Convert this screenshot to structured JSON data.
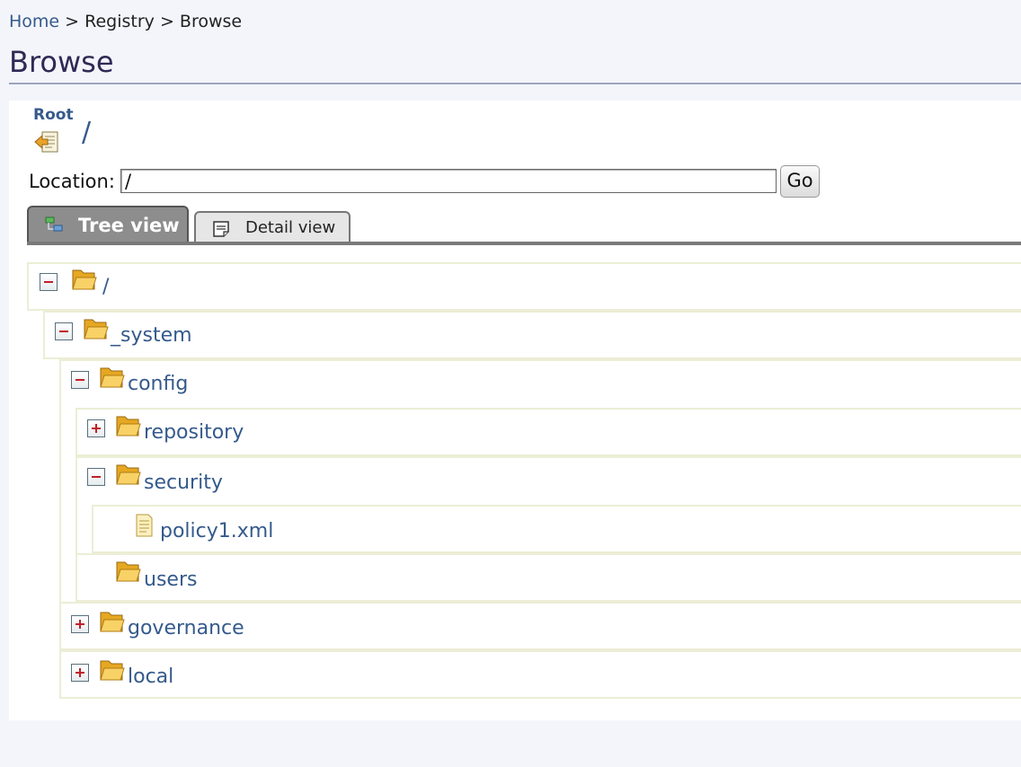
{
  "breadcrumb": {
    "home": "Home",
    "sep1": ">",
    "registry": "Registry",
    "sep2": ">",
    "current": "Browse"
  },
  "page": {
    "title": "Browse"
  },
  "root": {
    "label": "Root",
    "path": "/"
  },
  "location": {
    "label": "Location:",
    "value": "/",
    "go_label": "Go"
  },
  "tabs": {
    "tree_view": "Tree view",
    "detail_view": "Detail view",
    "active": "Tree view"
  },
  "tree": {
    "root": {
      "label": "/",
      "state": "expanded"
    },
    "system": {
      "label": "_system",
      "state": "expanded"
    },
    "config": {
      "label": "config",
      "state": "expanded"
    },
    "repository": {
      "label": "repository",
      "state": "collapsed"
    },
    "security": {
      "label": "security",
      "state": "expanded"
    },
    "policy": {
      "label": "policy1.xml",
      "type": "file"
    },
    "users": {
      "label": "users",
      "state": "leaf"
    },
    "governance": {
      "label": "governance",
      "state": "collapsed"
    },
    "local": {
      "label": "local",
      "state": "collapsed"
    }
  },
  "icons": {
    "root": "root-resource-icon",
    "folder": "folder-open-icon",
    "file": "file-icon",
    "expand": "plus-icon",
    "collapse": "minus-icon",
    "tree_tab": "tree-view-icon",
    "detail_tab": "detail-view-icon"
  },
  "colors": {
    "link": "#355a8c",
    "title": "#2d2a55",
    "background": "#f4f5fb",
    "folder": "#f4c04a",
    "toggle_sign": "#c0202a"
  }
}
